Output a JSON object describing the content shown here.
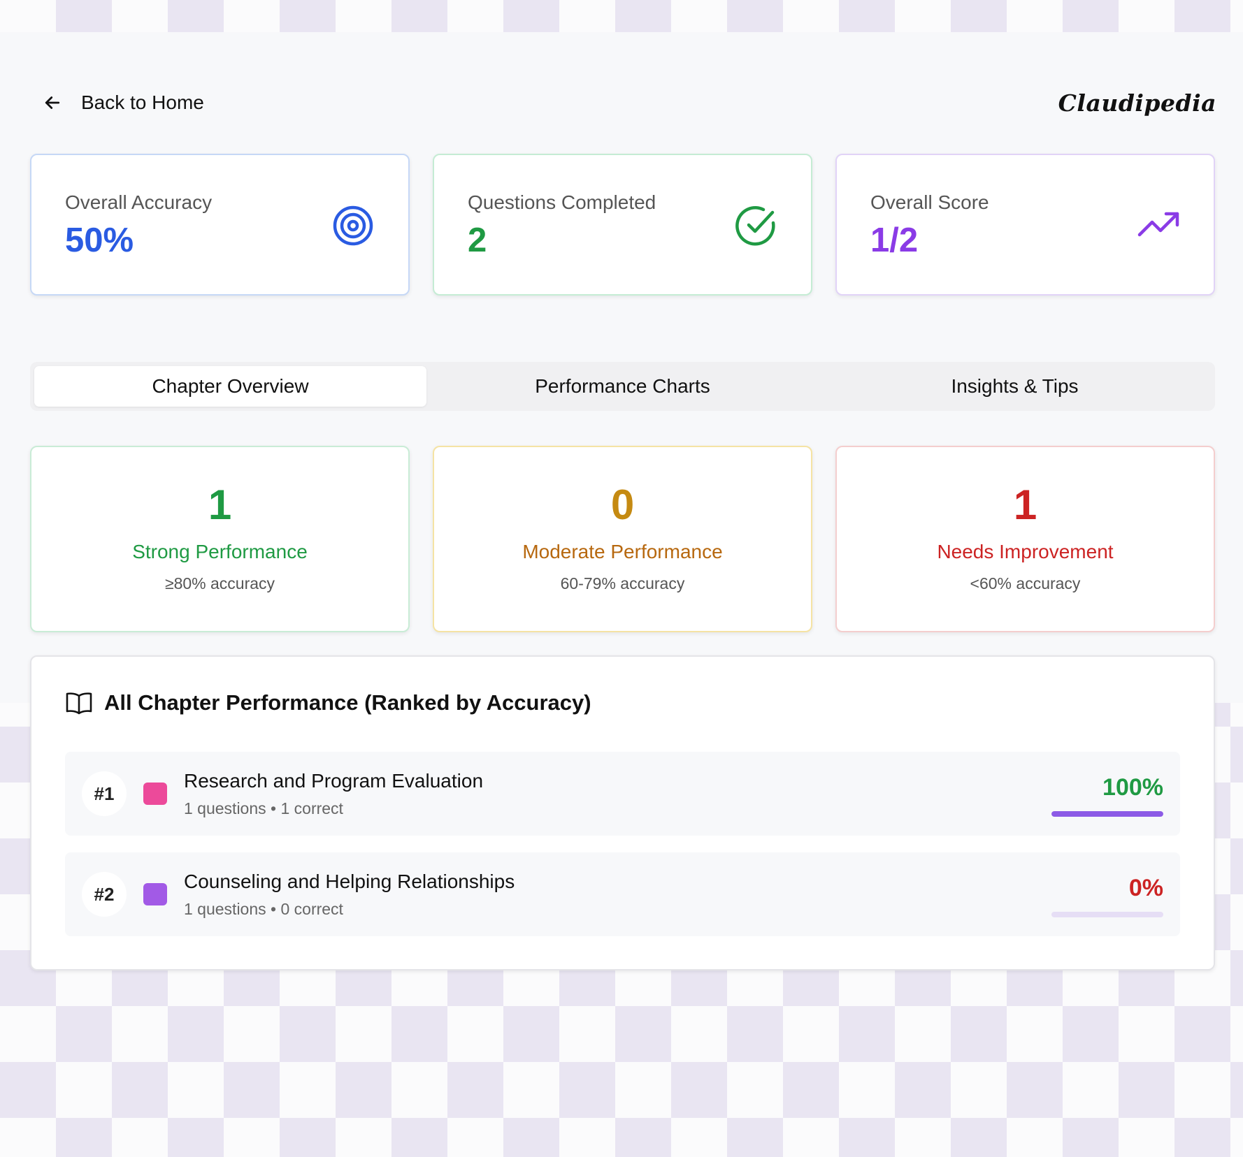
{
  "header": {
    "back_label": "Back to Home",
    "brand": "Claudipedia"
  },
  "stats": [
    {
      "label": "Overall Accuracy",
      "value": "50%",
      "icon": "target-icon",
      "color": "#2a5be2"
    },
    {
      "label": "Questions Completed",
      "value": "2",
      "icon": "check-circle-icon",
      "color": "#1f9a43"
    },
    {
      "label": "Overall Score",
      "value": "1/2",
      "icon": "trending-up-icon",
      "color": "#8a3be6"
    }
  ],
  "tabs": [
    {
      "label": "Chapter Overview",
      "active": true
    },
    {
      "label": "Performance Charts",
      "active": false
    },
    {
      "label": "Insights & Tips",
      "active": false
    }
  ],
  "performance": [
    {
      "count": "1",
      "title": "Strong Performance",
      "subtitle": "≥80% accuracy",
      "color": "#1f9a43"
    },
    {
      "count": "0",
      "title": "Moderate Performance",
      "subtitle": "60-79% accuracy",
      "color": "#b7680f"
    },
    {
      "count": "1",
      "title": "Needs Improvement",
      "subtitle": "<60% accuracy",
      "color": "#cc2323"
    }
  ],
  "chapters": {
    "title": "All Chapter Performance (Ranked by Accuracy)",
    "items": [
      {
        "rank": "#1",
        "name": "Research and Program Evaluation",
        "meta": "1 questions • 1 correct",
        "percent_label": "100%",
        "accuracy": 1.0,
        "swatch_color": "#ec4a9a",
        "percent_color": "#1f9a43"
      },
      {
        "rank": "#2",
        "name": "Counseling and Helping Relationships",
        "meta": "1 questions • 0 correct",
        "percent_label": "0%",
        "accuracy": 0.0,
        "swatch_color": "#a25ae6",
        "percent_color": "#cc2323"
      }
    ]
  }
}
